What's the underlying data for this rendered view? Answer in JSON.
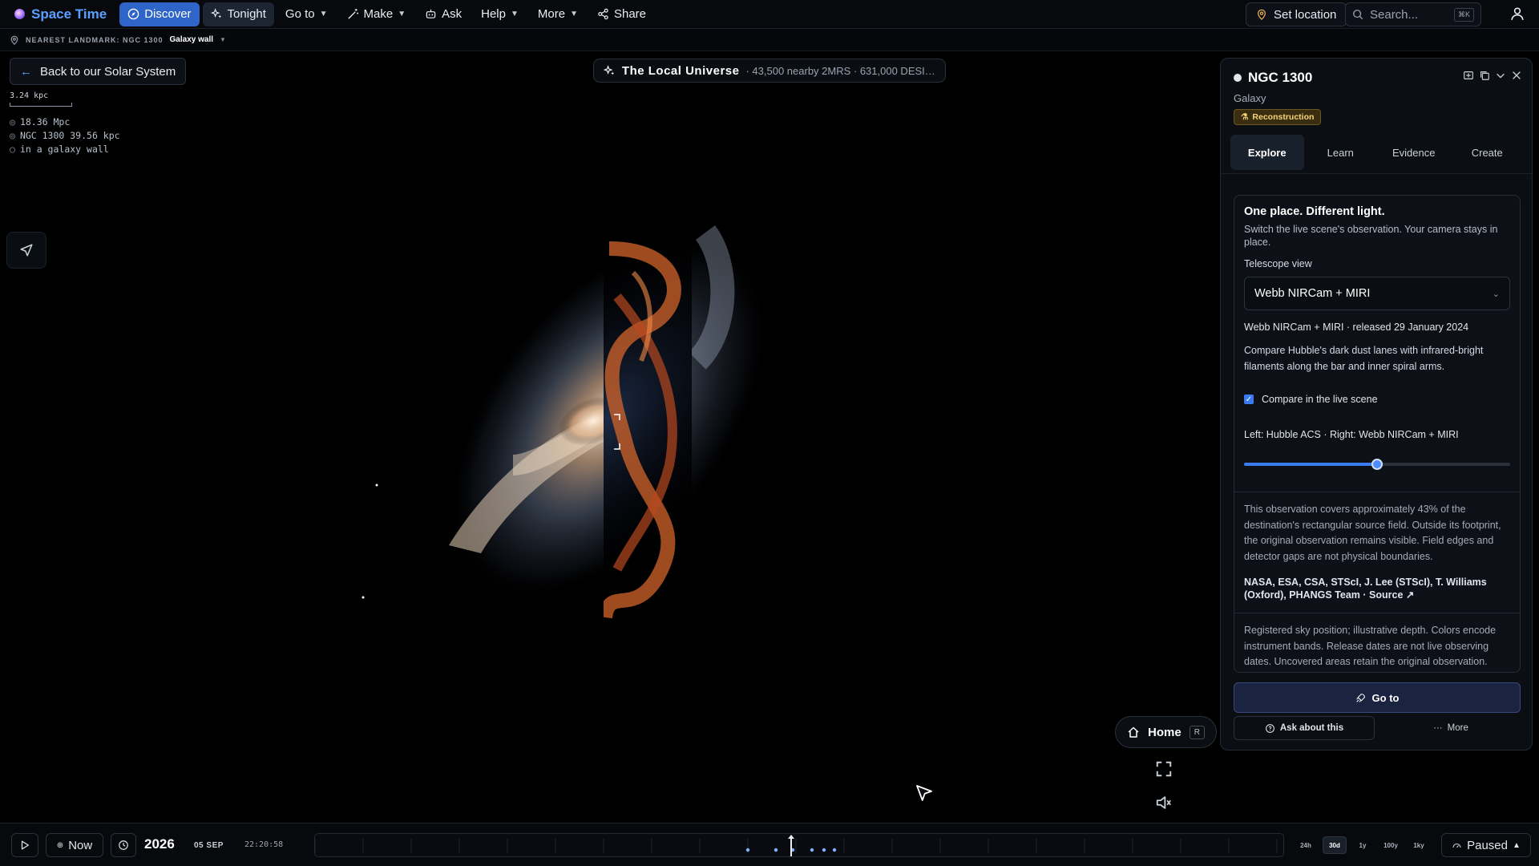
{
  "topbar": {
    "brand": "Space Time",
    "discover": "Discover",
    "tonight": "Tonight",
    "goto": "Go to",
    "make": "Make",
    "ask": "Ask",
    "help": "Help",
    "more": "More",
    "share": "Share",
    "set_location": "Set location",
    "search_placeholder": "Search...",
    "search_shortcut": "⌘K"
  },
  "landmark": {
    "label": "NEAREST LANDMARK: NGC 1300",
    "value": "Galaxy wall"
  },
  "back_button": "Back to our Solar System",
  "scale_label": "3.24 kpc",
  "readouts": [
    "18.36 Mpc",
    "NGC 1300 39.56 kpc",
    "in a galaxy wall"
  ],
  "scene": {
    "title": "The Local Universe",
    "subtitle": "· 43,500 nearby 2MRS · 631,000 DESI ..."
  },
  "home": {
    "label": "Home",
    "key": "R"
  },
  "panel": {
    "title": "NGC 1300",
    "subtitle": "Galaxy",
    "badge": "Reconstruction",
    "tabs": [
      {
        "label": "Explore",
        "active": true
      },
      {
        "label": "Learn",
        "active": false
      },
      {
        "label": "Evidence",
        "active": false
      },
      {
        "label": "Create",
        "active": false
      }
    ],
    "card": {
      "heading": "One place. Different light.",
      "intro": "Switch the live scene's observation. Your camera stays in place.",
      "telescope_label": "Telescope view",
      "telescope_value": "Webb NIRCam + MIRI",
      "release": "Webb NIRCam + MIRI · released 29 January 2024",
      "compare_desc": "Compare Hubble's dark dust lanes with infrared-bright filaments along the bar and inner spiral arms.",
      "compare_checkbox": "Compare in the live scene",
      "compare_checked": true,
      "lr_label": "Left: Hubble ACS · Right: Webb NIRCam + MIRI",
      "slider_value": 0.5,
      "coverage": "This observation covers approximately 43% of the destination's rectangular source field. Outside its footprint, the original observation remains visible. Field edges and detector gaps are not physical boundaries.",
      "credits": "NASA, ESA, CSA, STScI, J. Lee (STScI), T. Williams (Oxford), PHANGS Team · Source ↗",
      "disclaimer": "Registered sky position; illustrative depth. Colors encode instrument bands. Release dates are not live observing dates. Uncovered areas retain the original observation."
    },
    "goto_button": "Go to",
    "ask_button": "Ask about this",
    "more_button": "More"
  },
  "timeline": {
    "now": "Now",
    "year": "2026",
    "date": "05 SEP",
    "clock": "22:20:58",
    "zoom_levels": [
      "24h",
      "30d",
      "1y",
      "100y",
      "1ky"
    ],
    "active_zoom": "30d",
    "state": "Paused"
  },
  "colors": {
    "accent": "#2f64c9",
    "badge": "#f5d27a",
    "slider": "#3b7bf0"
  }
}
